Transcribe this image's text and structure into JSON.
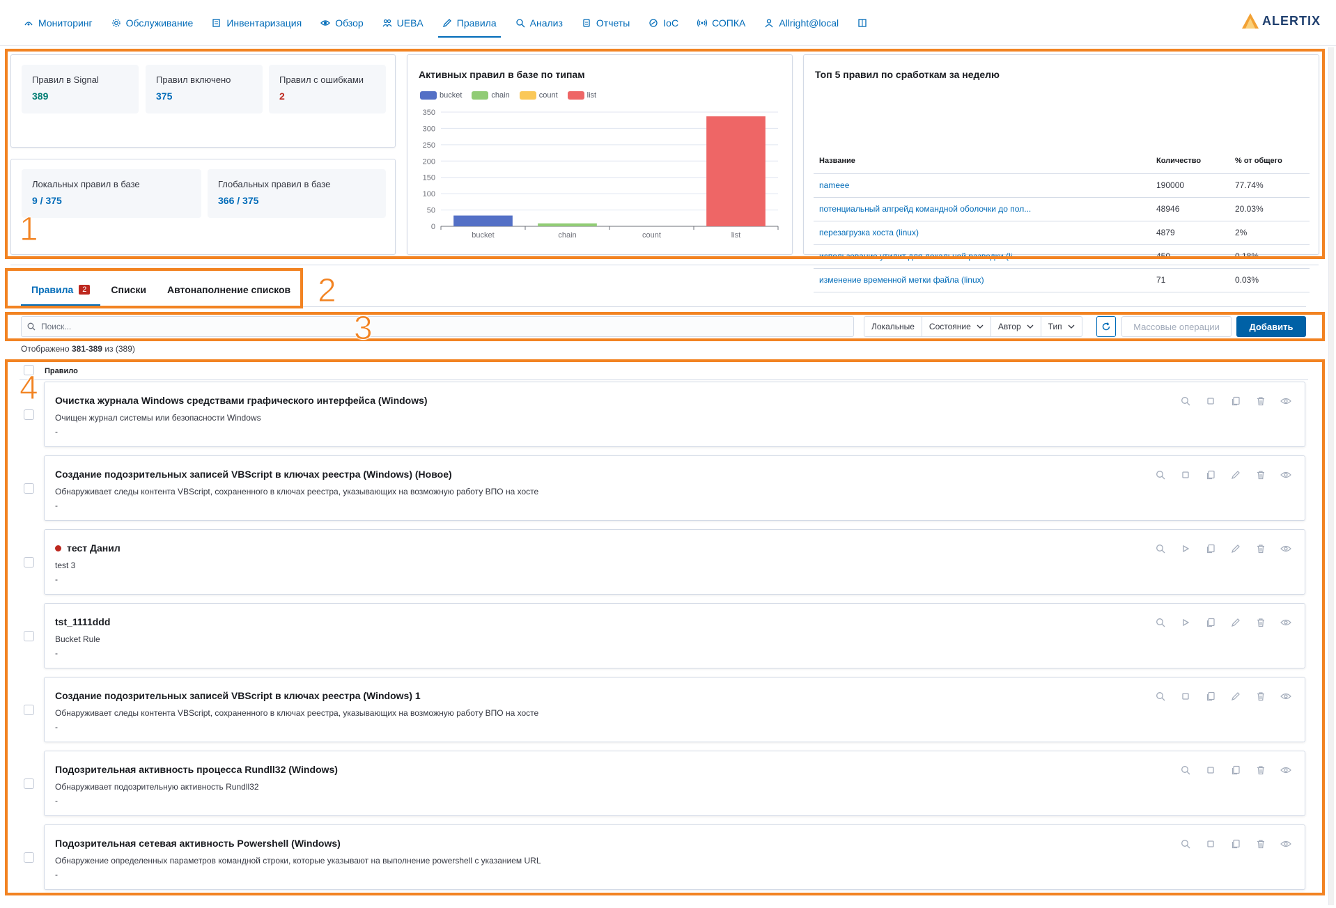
{
  "nav": {
    "items": [
      {
        "label": "Мониторинг",
        "icon": "monitoring-icon"
      },
      {
        "label": "Обслуживание",
        "icon": "gear-icon"
      },
      {
        "label": "Инвентаризация",
        "icon": "inventory-icon"
      },
      {
        "label": "Обзор",
        "icon": "eye-icon"
      },
      {
        "label": "UEBA",
        "icon": "users-icon"
      },
      {
        "label": "Правила",
        "icon": "pencil-icon"
      },
      {
        "label": "Анализ",
        "icon": "analysis-icon"
      },
      {
        "label": "Отчеты",
        "icon": "report-icon"
      },
      {
        "label": "IoC",
        "icon": "ioc-icon"
      },
      {
        "label": "СОПКА",
        "icon": "signal-icon"
      },
      {
        "label": "Allright@local",
        "icon": "user-icon"
      }
    ],
    "active": "Правила",
    "logo_text": "ALERTIX"
  },
  "stats": {
    "rules_in_signal_label": "Правил в Signal",
    "rules_in_signal_value": "389",
    "rules_enabled_label": "Правил включено",
    "rules_enabled_value": "375",
    "rules_errors_label": "Правил с ошибками",
    "rules_errors_value": "2",
    "local_label": "Локальных правил в базе",
    "local_value": "9 / 375",
    "global_label": "Глобальных правил в базе",
    "global_value": "366 / 375"
  },
  "chart_data": {
    "type": "bar",
    "title": "Активных правил в базе по типам",
    "categories": [
      "bucket",
      "chain",
      "count",
      "list"
    ],
    "values": [
      33,
      9,
      0,
      337
    ],
    "colors": [
      "#5470c6",
      "#91cc75",
      "#fac858",
      "#ee6666"
    ],
    "legend": [
      "bucket",
      "chain",
      "count",
      "list"
    ],
    "ylim": [
      0,
      350
    ],
    "yticks": [
      0,
      50,
      100,
      150,
      200,
      250,
      300,
      350
    ],
    "grid": true,
    "legend_position": "top-left"
  },
  "top5": {
    "title": "Топ 5 правил по сработкам за неделю",
    "headers": [
      "Название",
      "Количество",
      "% от общего"
    ],
    "rows": [
      [
        "nameee",
        "190000",
        "77.74%"
      ],
      [
        "потенциальный апгрейд командной оболочки до пол...",
        "48946",
        "20.03%"
      ],
      [
        "перезагрузка хоста (linux)",
        "4879",
        "2%"
      ],
      [
        "использование утилит для локальной разведки (li...",
        "450",
        "0.18%"
      ],
      [
        "изменение временной метки файла (linux)",
        "71",
        "0.03%"
      ]
    ]
  },
  "tabs": {
    "rules": "Правила",
    "rules_badge": "2",
    "lists": "Списки",
    "autofill": "Автонаполнение списков"
  },
  "toolbar": {
    "search_placeholder": "Поиск...",
    "filter_local": "Локальные",
    "filter_state": "Состояние",
    "filter_author": "Автор",
    "filter_type": "Тип",
    "bulk": "Массовые операции",
    "add": "Добавить"
  },
  "shown": {
    "prefix": "Отображено",
    "range": "381-389",
    "of": "из",
    "total": "(389)"
  },
  "list": {
    "header": "Правило",
    "rules": [
      {
        "title": "Очистка журнала Windows средствами графического интерфейса (Windows)",
        "desc": "Очищен журнал системы или безопасности Windows",
        "extra": "-",
        "error": false,
        "run": "stop",
        "editable": false
      },
      {
        "title": "Создание подозрительных записей VBScript в ключах реестра (Windows) (Новое)",
        "desc": "Обнаруживает следы контента VBScript, сохраненного в ключах реестра, указывающих на возможную работу ВПО на хосте",
        "extra": "-",
        "error": false,
        "run": "stop",
        "editable": true
      },
      {
        "title": "тест Данил",
        "desc": "test 3",
        "extra": "-",
        "error": true,
        "run": "play",
        "editable": true
      },
      {
        "title": "tst_1111ddd",
        "desc": "Bucket Rule",
        "extra": "-",
        "error": false,
        "run": "play",
        "editable": true
      },
      {
        "title": "Создание подозрительных записей VBScript в ключах реестра (Windows) 1",
        "desc": "Обнаруживает следы контента VBScript, сохраненного в ключах реестра, указывающих на возможную работу ВПО на хосте",
        "extra": "-",
        "error": false,
        "run": "stop",
        "editable": true
      },
      {
        "title": "Подозрительная активность процесса Rundll32 (Windows)",
        "desc": "Обнаруживает подозрительную активность Rundll32",
        "extra": "-",
        "error": false,
        "run": "stop",
        "editable": false
      },
      {
        "title": "Подозрительная сетевая активность Powershell (Windows)",
        "desc": "Обнаружение определенных параметров командной строки, которые указывают на выполнение powershell с указанием URL",
        "extra": "-",
        "error": false,
        "run": "stop",
        "editable": false
      }
    ]
  },
  "annotations": [
    "1",
    "2",
    "3",
    "4"
  ]
}
